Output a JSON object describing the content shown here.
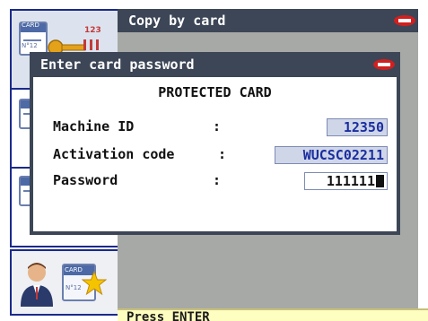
{
  "header": {
    "title": "Copy by card"
  },
  "dialog": {
    "title": "Enter card password",
    "heading": "PROTECTED CARD",
    "fields": [
      {
        "label": "Machine ID",
        "colon": ":",
        "value": "12350"
      },
      {
        "label": "Activation code",
        "colon": ":",
        "value": "WUCSC02211"
      },
      {
        "label": "Password",
        "colon": ":",
        "value": "111111"
      }
    ]
  },
  "status": {
    "text": "Press ENTER"
  },
  "thumbnails": {
    "card_label": "CARD",
    "card_number": "N°12",
    "numbers_badge": "123"
  },
  "colors": {
    "header_bg": "#3c4656",
    "panel_bg": "#a7a9a7",
    "status_bg": "#fefec0",
    "value_text": "#1b2ea0",
    "thumb_border": "#1a2a8a"
  }
}
